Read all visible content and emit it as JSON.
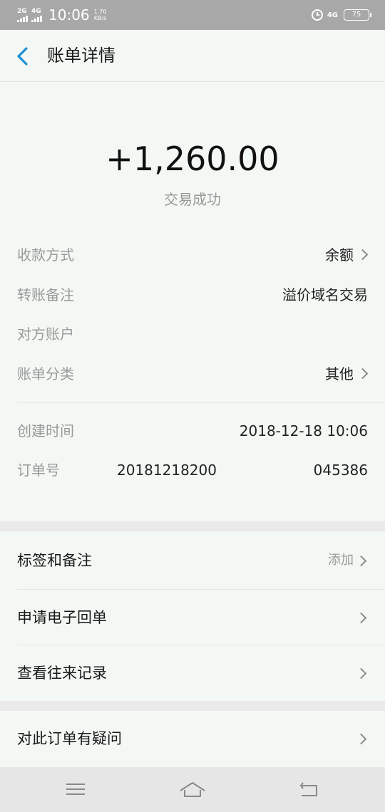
{
  "status_bar": {
    "sim1": "2G",
    "sim2": "4G",
    "time": "10:06",
    "speed_value": "1.70",
    "speed_unit": "KB/s",
    "network": "4G",
    "battery": "75"
  },
  "header": {
    "title": "账单详情"
  },
  "summary": {
    "amount": "+1,260.00",
    "status": "交易成功"
  },
  "details": {
    "payment_method": {
      "label": "收款方式",
      "value": "余额"
    },
    "transfer_note": {
      "label": "转账备注",
      "value": "溢价域名交易"
    },
    "counterparty": {
      "label": "对方账户",
      "value": ""
    },
    "category": {
      "label": "账单分类",
      "value": "其他"
    },
    "created": {
      "label": "创建时间",
      "value": "2018-12-18 10:06"
    },
    "order": {
      "label": "订单号",
      "value_part1": "20181218200",
      "value_part2": "045386"
    }
  },
  "actions": {
    "tags": {
      "label": "标签和备注",
      "hint": "添加"
    },
    "receipt": {
      "label": "申请电子回单"
    },
    "history": {
      "label": "查看往来记录"
    },
    "dispute": {
      "label": "对此订单有疑问"
    }
  },
  "colors": {
    "accent": "#1e8fd6",
    "background": "#f4f8f4",
    "status_bar": "#a8a8a8"
  }
}
